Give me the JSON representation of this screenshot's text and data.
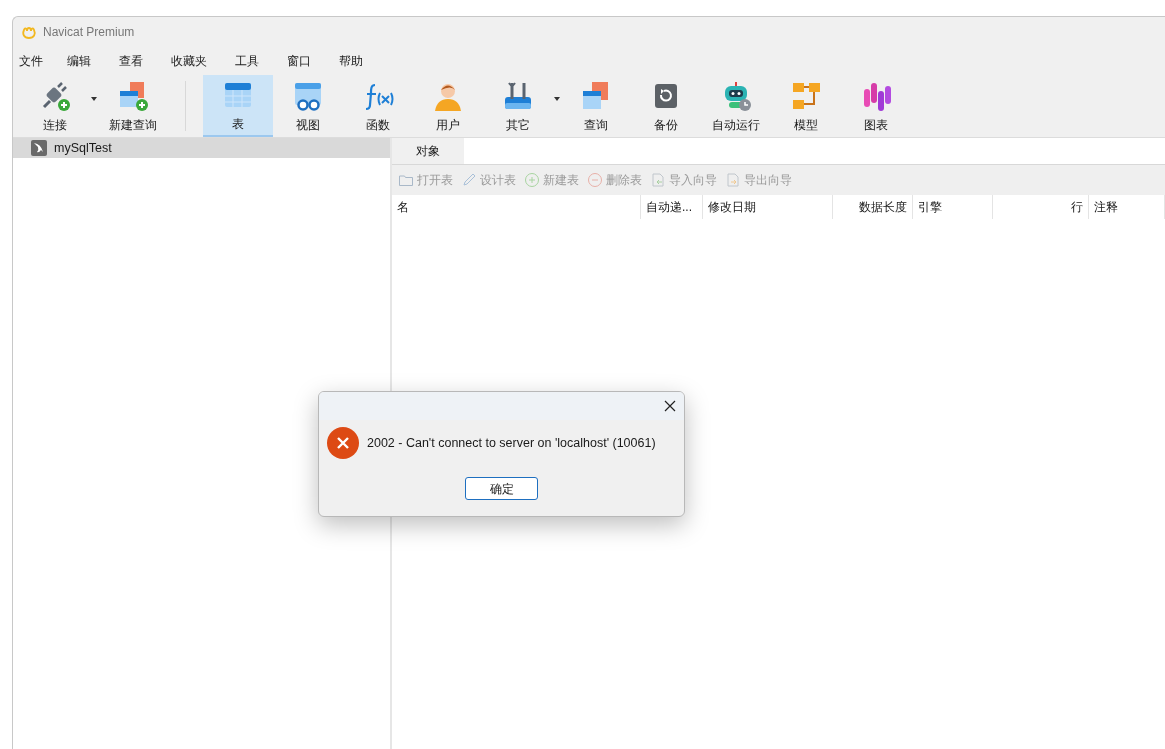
{
  "window": {
    "title": "Navicat Premium"
  },
  "menu": [
    "文件",
    "编辑",
    "查看",
    "收藏夹",
    "工具",
    "窗口",
    "帮助"
  ],
  "toolbar": [
    {
      "kind": "connect",
      "label": "连接",
      "selected": false,
      "dropdown": true
    },
    {
      "kind": "new-query",
      "label": "新建查询",
      "selected": false,
      "dropdown": false,
      "separator_after": true
    },
    {
      "kind": "table",
      "label": "表",
      "selected": true,
      "dropdown": false
    },
    {
      "kind": "view",
      "label": "视图",
      "selected": false,
      "dropdown": false
    },
    {
      "kind": "function",
      "label": "函数",
      "selected": false,
      "dropdown": false
    },
    {
      "kind": "user",
      "label": "用户",
      "selected": false,
      "dropdown": false
    },
    {
      "kind": "other",
      "label": "其它",
      "selected": false,
      "dropdown": true
    },
    {
      "kind": "query",
      "label": "查询",
      "selected": false,
      "dropdown": false
    },
    {
      "kind": "backup",
      "label": "备份",
      "selected": false,
      "dropdown": false
    },
    {
      "kind": "automation",
      "label": "自动运行",
      "selected": false,
      "dropdown": false
    },
    {
      "kind": "model",
      "label": "模型",
      "selected": false,
      "dropdown": false
    },
    {
      "kind": "chart",
      "label": "图表",
      "selected": false,
      "dropdown": false
    }
  ],
  "sidebar": {
    "connections": [
      {
        "name": "mySqlTest",
        "selected": true
      }
    ]
  },
  "tabs": [
    {
      "label": "对象",
      "selected": true
    }
  ],
  "object_actions": [
    {
      "kind": "open",
      "label": "打开表",
      "disabled": true
    },
    {
      "kind": "design",
      "label": "设计表",
      "disabled": true
    },
    {
      "kind": "new",
      "label": "新建表",
      "disabled": true
    },
    {
      "kind": "delete",
      "label": "删除表",
      "disabled": true
    },
    {
      "kind": "import",
      "label": "导入向导",
      "disabled": true
    },
    {
      "kind": "export",
      "label": "导出向导",
      "disabled": true
    }
  ],
  "table": {
    "columns": [
      {
        "label": "名"
      },
      {
        "label": "自动递..."
      },
      {
        "label": "修改日期"
      },
      {
        "label": "数据长度"
      },
      {
        "label": "引擎"
      },
      {
        "label": "行"
      },
      {
        "label": "注释"
      }
    ]
  },
  "dialog": {
    "message": "2002 - Can't connect to server on 'localhost' (10061)",
    "button": "确定"
  }
}
